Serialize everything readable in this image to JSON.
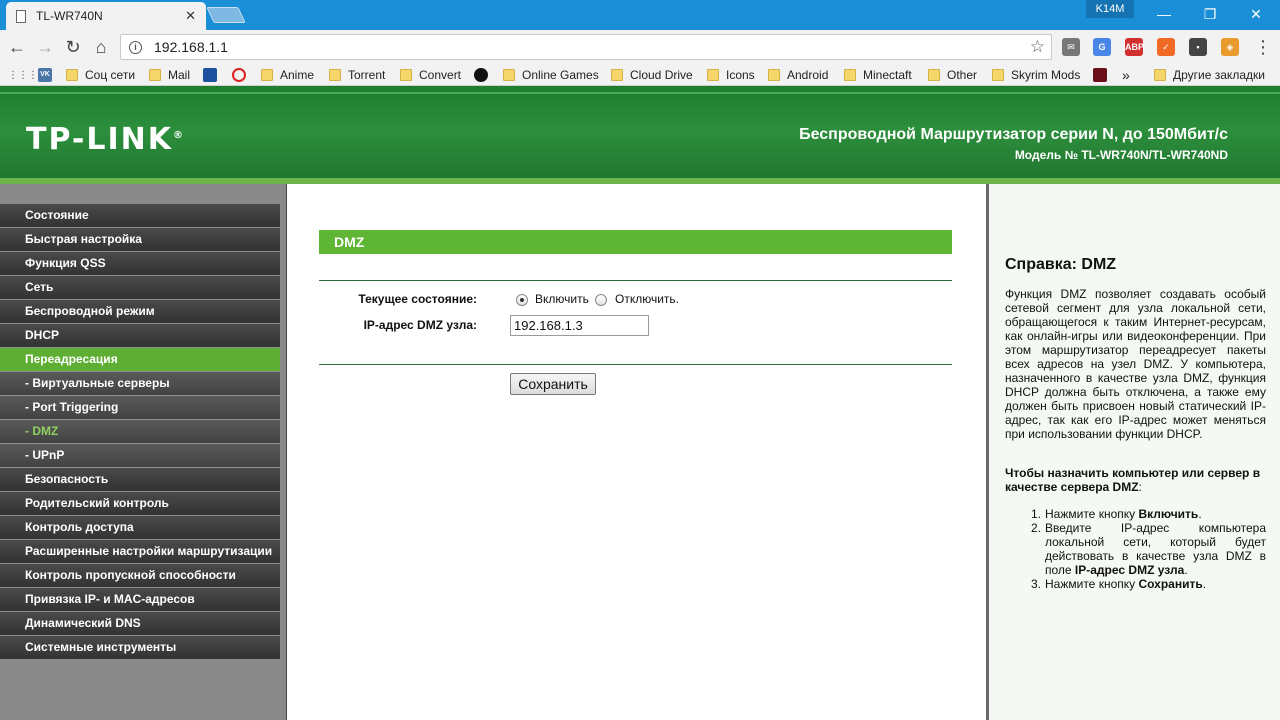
{
  "browser": {
    "tab_title": "TL-WR740N",
    "tab_close": "✕",
    "profile": "K14M",
    "minimize": "—",
    "restore": "❐",
    "close": "✕",
    "url": "192.168.1.1",
    "back": "←",
    "forward": "→",
    "reload": "↻",
    "home": "⌂",
    "star": "☆",
    "menu": "⋮",
    "extensions": [
      {
        "name": "mail",
        "color": "#777777",
        "label": "✉"
      },
      {
        "name": "translate",
        "color": "#4a86e8",
        "label": "G"
      },
      {
        "name": "adblock",
        "color": "#d32f2f",
        "label": "ABP"
      },
      {
        "name": "ext-orange",
        "color": "#f06a25",
        "label": "✓"
      },
      {
        "name": "ext-dark",
        "color": "#444444",
        "label": "▪"
      },
      {
        "name": "ext-colors",
        "color": "#e89a2c",
        "label": "◈"
      }
    ],
    "bookmarks": {
      "apps": "⋮⋮⋮",
      "vk": "VK",
      "social": "Соц сети",
      "mail": "Mail",
      "anime": "Anime",
      "torrent": "Torrent",
      "convert": "Convert",
      "online_games": "Online Games",
      "cloud_drive": "Cloud Drive",
      "icons": "Icons",
      "android": "Android",
      "minecraft": "Minectaft",
      "other": "Other",
      "skyrim": "Skyrim Mods",
      "more": "»",
      "other_bookmarks": "Другие закладки"
    }
  },
  "header": {
    "logo": "TP-LINK",
    "title": "Беспроводной Маршрутизатор серии N, до 150Мбит/с",
    "model": "Модель № TL-WR740N/TL-WR740ND"
  },
  "menu": [
    {
      "label": "Состояние",
      "kind": "item"
    },
    {
      "label": "Быстрая настройка",
      "kind": "item"
    },
    {
      "label": "Функция QSS",
      "kind": "item"
    },
    {
      "label": "Сеть",
      "kind": "item"
    },
    {
      "label": "Беспроводной режим",
      "kind": "item"
    },
    {
      "label": "DHCP",
      "kind": "item"
    },
    {
      "label": "Переадресация",
      "kind": "active"
    },
    {
      "label": "- Виртуальные серверы",
      "kind": "sub"
    },
    {
      "label": "- Port Triggering",
      "kind": "sub"
    },
    {
      "label": "- DMZ",
      "kind": "sub-active"
    },
    {
      "label": "- UPnP",
      "kind": "sub"
    },
    {
      "label": "Безопасность",
      "kind": "item"
    },
    {
      "label": "Родительский контроль",
      "kind": "item"
    },
    {
      "label": "Контроль доступа",
      "kind": "item"
    },
    {
      "label": "Расширенные настройки маршрутизации",
      "kind": "item"
    },
    {
      "label": "Контроль пропускной способности",
      "kind": "item"
    },
    {
      "label": "Привязка IP- и MAC-адресов",
      "kind": "item"
    },
    {
      "label": "Динамический DNS",
      "kind": "item"
    },
    {
      "label": "Системные инструменты",
      "kind": "item"
    }
  ],
  "dmz": {
    "section_title": "DMZ",
    "status_label": "Текущее состояние:",
    "enable_label": "Включить",
    "disable_label": "Отключить.",
    "enabled": true,
    "ip_label": "IP-адрес DMZ узла:",
    "ip_value": "192.168.1.3",
    "save_label": "Сохранить"
  },
  "help": {
    "title": "Справка: DMZ",
    "body": "Функция DMZ позволяет создавать особый сетевой сегмент для узла локальной сети, обращающегося к таким Интернет-ресурсам, как онлайн-игры или видеоконференции. При этом маршрутизатор переадресует пакеты всех адресов на узел DMZ. У компьютера, назначенного в качестве узла DMZ, функция DHCP должна быть отключена, а также ему должен быть присвоен новый статический IP-адрес, так как его IP-адрес может меняться при использовании функции DHCP.",
    "subtitle": "Чтобы назначить компьютер или сервер в качестве сервера DMZ",
    "subtitle_colon": ":",
    "step1_num": "1.",
    "step1_text": "Нажмите кнопку ",
    "step1_bold": "Включить",
    "step1_end": ".",
    "step2_num": "2.",
    "step2_text": "Введите IP-адрес компьютера локальной сети, который будет действовать в качестве узла DMZ в поле ",
    "step2_bold": "IP-адрес DMZ узла",
    "step2_end": ".",
    "step3_num": "3.",
    "step3_text": "Нажмите кнопку ",
    "step3_bold": "Сохранить",
    "step3_end": "."
  }
}
